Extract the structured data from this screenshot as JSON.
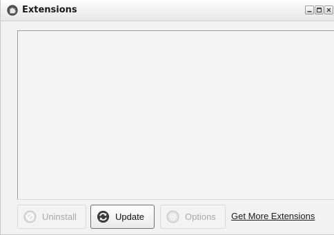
{
  "window": {
    "title": "Extensions",
    "icon": "puzzle-globe-icon"
  },
  "window_controls": {
    "minimize_icon": "minimize-icon",
    "maximize_icon": "maximize-icon",
    "close_icon": "close-icon"
  },
  "extension_list": {
    "items": []
  },
  "buttons": {
    "uninstall": {
      "label": "Uninstall",
      "icon": "uninstall-icon",
      "enabled": false
    },
    "update": {
      "label": "Update",
      "icon": "update-icon",
      "enabled": true
    },
    "options": {
      "label": "Options",
      "icon": "options-gear-icon",
      "enabled": false
    }
  },
  "links": {
    "get_more": "Get More Extensions"
  },
  "colors": {
    "disabled_text": "#a8a8a8",
    "titlebar": "#f3f3f3",
    "content_bg": "#f4f4f4"
  }
}
